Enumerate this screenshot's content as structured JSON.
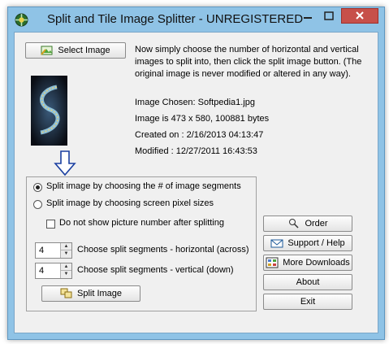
{
  "window": {
    "title": "Split and Tile Image Splitter - UNREGISTERED"
  },
  "top": {
    "select_label": "Select Image",
    "instructions": "Now simply choose the number of horizontal and vertical images to split into, then click the split image button. (The original image is never modified or altered in any way).",
    "image_chosen": "Image Chosen: Softpedia1.jpg",
    "image_size": "Image is 473 x 580, 100881 bytes",
    "created": "Created on : 2/16/2013 04:13:47",
    "modified": "Modified : 12/27/2011 16:43:53"
  },
  "options": {
    "radio_segments": "Split image by choosing the # of image segments",
    "radio_pixels": "Split image by choosing screen pixel sizes",
    "no_number": "Do not show picture number after splitting",
    "horizontal_value": "4",
    "horizontal_label": "Choose split segments - horizontal (across)",
    "vertical_value": "4",
    "vertical_label": "Choose split segments - vertical (down)",
    "split_label": "Split Image"
  },
  "right_buttons": {
    "order": "Order",
    "support": "Support / Help",
    "downloads": "More Downloads",
    "about": "About",
    "exit": "Exit"
  }
}
